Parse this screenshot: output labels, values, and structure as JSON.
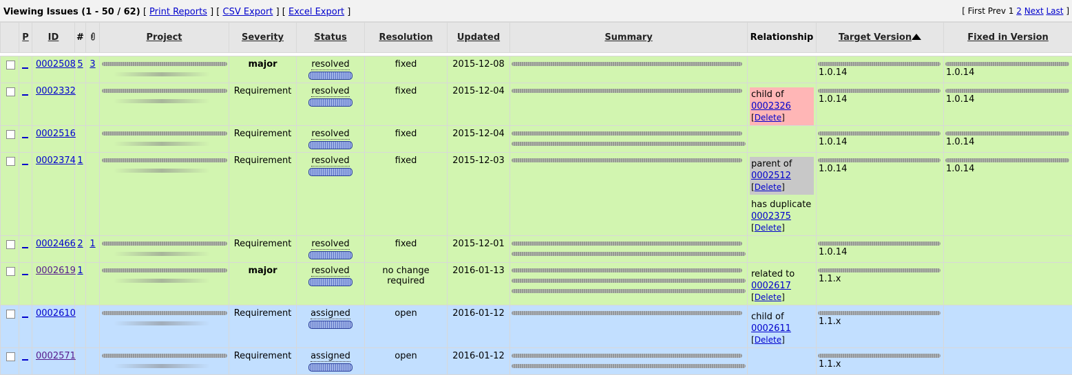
{
  "header": {
    "title": "Viewing Issues (1 - 50 / 62)",
    "print_reports": "Print Reports",
    "csv_export": "CSV Export",
    "excel_export": "Excel Export",
    "first_prev": "[ First Prev 1",
    "page2": "2",
    "next": "Next",
    "last": "Last",
    "close_bracket": "]"
  },
  "columns": {
    "p": "P",
    "id": "ID",
    "notes": "#",
    "attach_icon": "paperclip-icon",
    "project": "Project",
    "severity": "Severity",
    "status": "Status",
    "resolution": "Resolution",
    "updated": "Updated",
    "summary": "Summary",
    "relationship": "Relationship",
    "target_version": "Target Version",
    "fixed_in_version": "Fixed in Version"
  },
  "colors": {
    "resolved_row": "#d2f5b0",
    "assigned_row": "#c2dfff",
    "child_relationship": "#ffb6b6",
    "parent_relationship": "#c8c8c8"
  },
  "rows": [
    {
      "id": "0002508",
      "notes": "5",
      "attach": "3",
      "severity": "major",
      "status": "resolved",
      "resolution": "fixed",
      "updated": "2015-12-08",
      "target": "1.0.14",
      "fixed": "1.0.14"
    },
    {
      "id": "0002332",
      "notes": "",
      "attach": "",
      "severity": "Requirement",
      "status": "resolved",
      "resolution": "fixed",
      "updated": "2015-12-04",
      "rel_label": "child of",
      "rel_id": "0002326",
      "rel_delete": "Delete",
      "target": "1.0.14",
      "fixed": "1.0.14"
    },
    {
      "id": "0002516",
      "notes": "",
      "attach": "",
      "severity": "Requirement",
      "status": "resolved",
      "resolution": "fixed",
      "updated": "2015-12-04",
      "target": "1.0.14",
      "fixed": "1.0.14"
    },
    {
      "id": "0002374",
      "notes": "1",
      "attach": "",
      "severity": "Requirement",
      "status": "resolved",
      "resolution": "fixed",
      "updated": "2015-12-03",
      "rel_label": "parent of",
      "rel_id": "0002512",
      "rel_delete": "Delete",
      "rel2_label": "has duplicate",
      "rel2_id": "0002375",
      "rel2_delete": "Delete",
      "target": "1.0.14",
      "fixed": "1.0.14"
    },
    {
      "id": "0002466",
      "notes": "2",
      "attach": "1",
      "severity": "Requirement",
      "status": "resolved",
      "resolution": "fixed",
      "updated": "2015-12-01",
      "target": "1.0.14",
      "fixed": ""
    },
    {
      "id": "0002619",
      "notes": "1",
      "attach": "",
      "severity": "major",
      "status": "resolved",
      "resolution": "no change required",
      "updated": "2016-01-13",
      "rel_label": "related to",
      "rel_id": "0002617",
      "rel_delete": "Delete",
      "target": "1.1.x",
      "fixed": ""
    },
    {
      "id": "0002610",
      "notes": "",
      "attach": "",
      "severity": "Requirement",
      "status": "assigned",
      "resolution": "open",
      "updated": "2016-01-12",
      "rel_label": "child of",
      "rel_id": "0002611",
      "rel_delete": "Delete",
      "target": "1.1.x",
      "fixed": ""
    },
    {
      "id": "0002571",
      "notes": "",
      "attach": "",
      "severity": "Requirement",
      "status": "assigned",
      "resolution": "open",
      "updated": "2016-01-12",
      "target": "1.1.x",
      "fixed": ""
    }
  ]
}
